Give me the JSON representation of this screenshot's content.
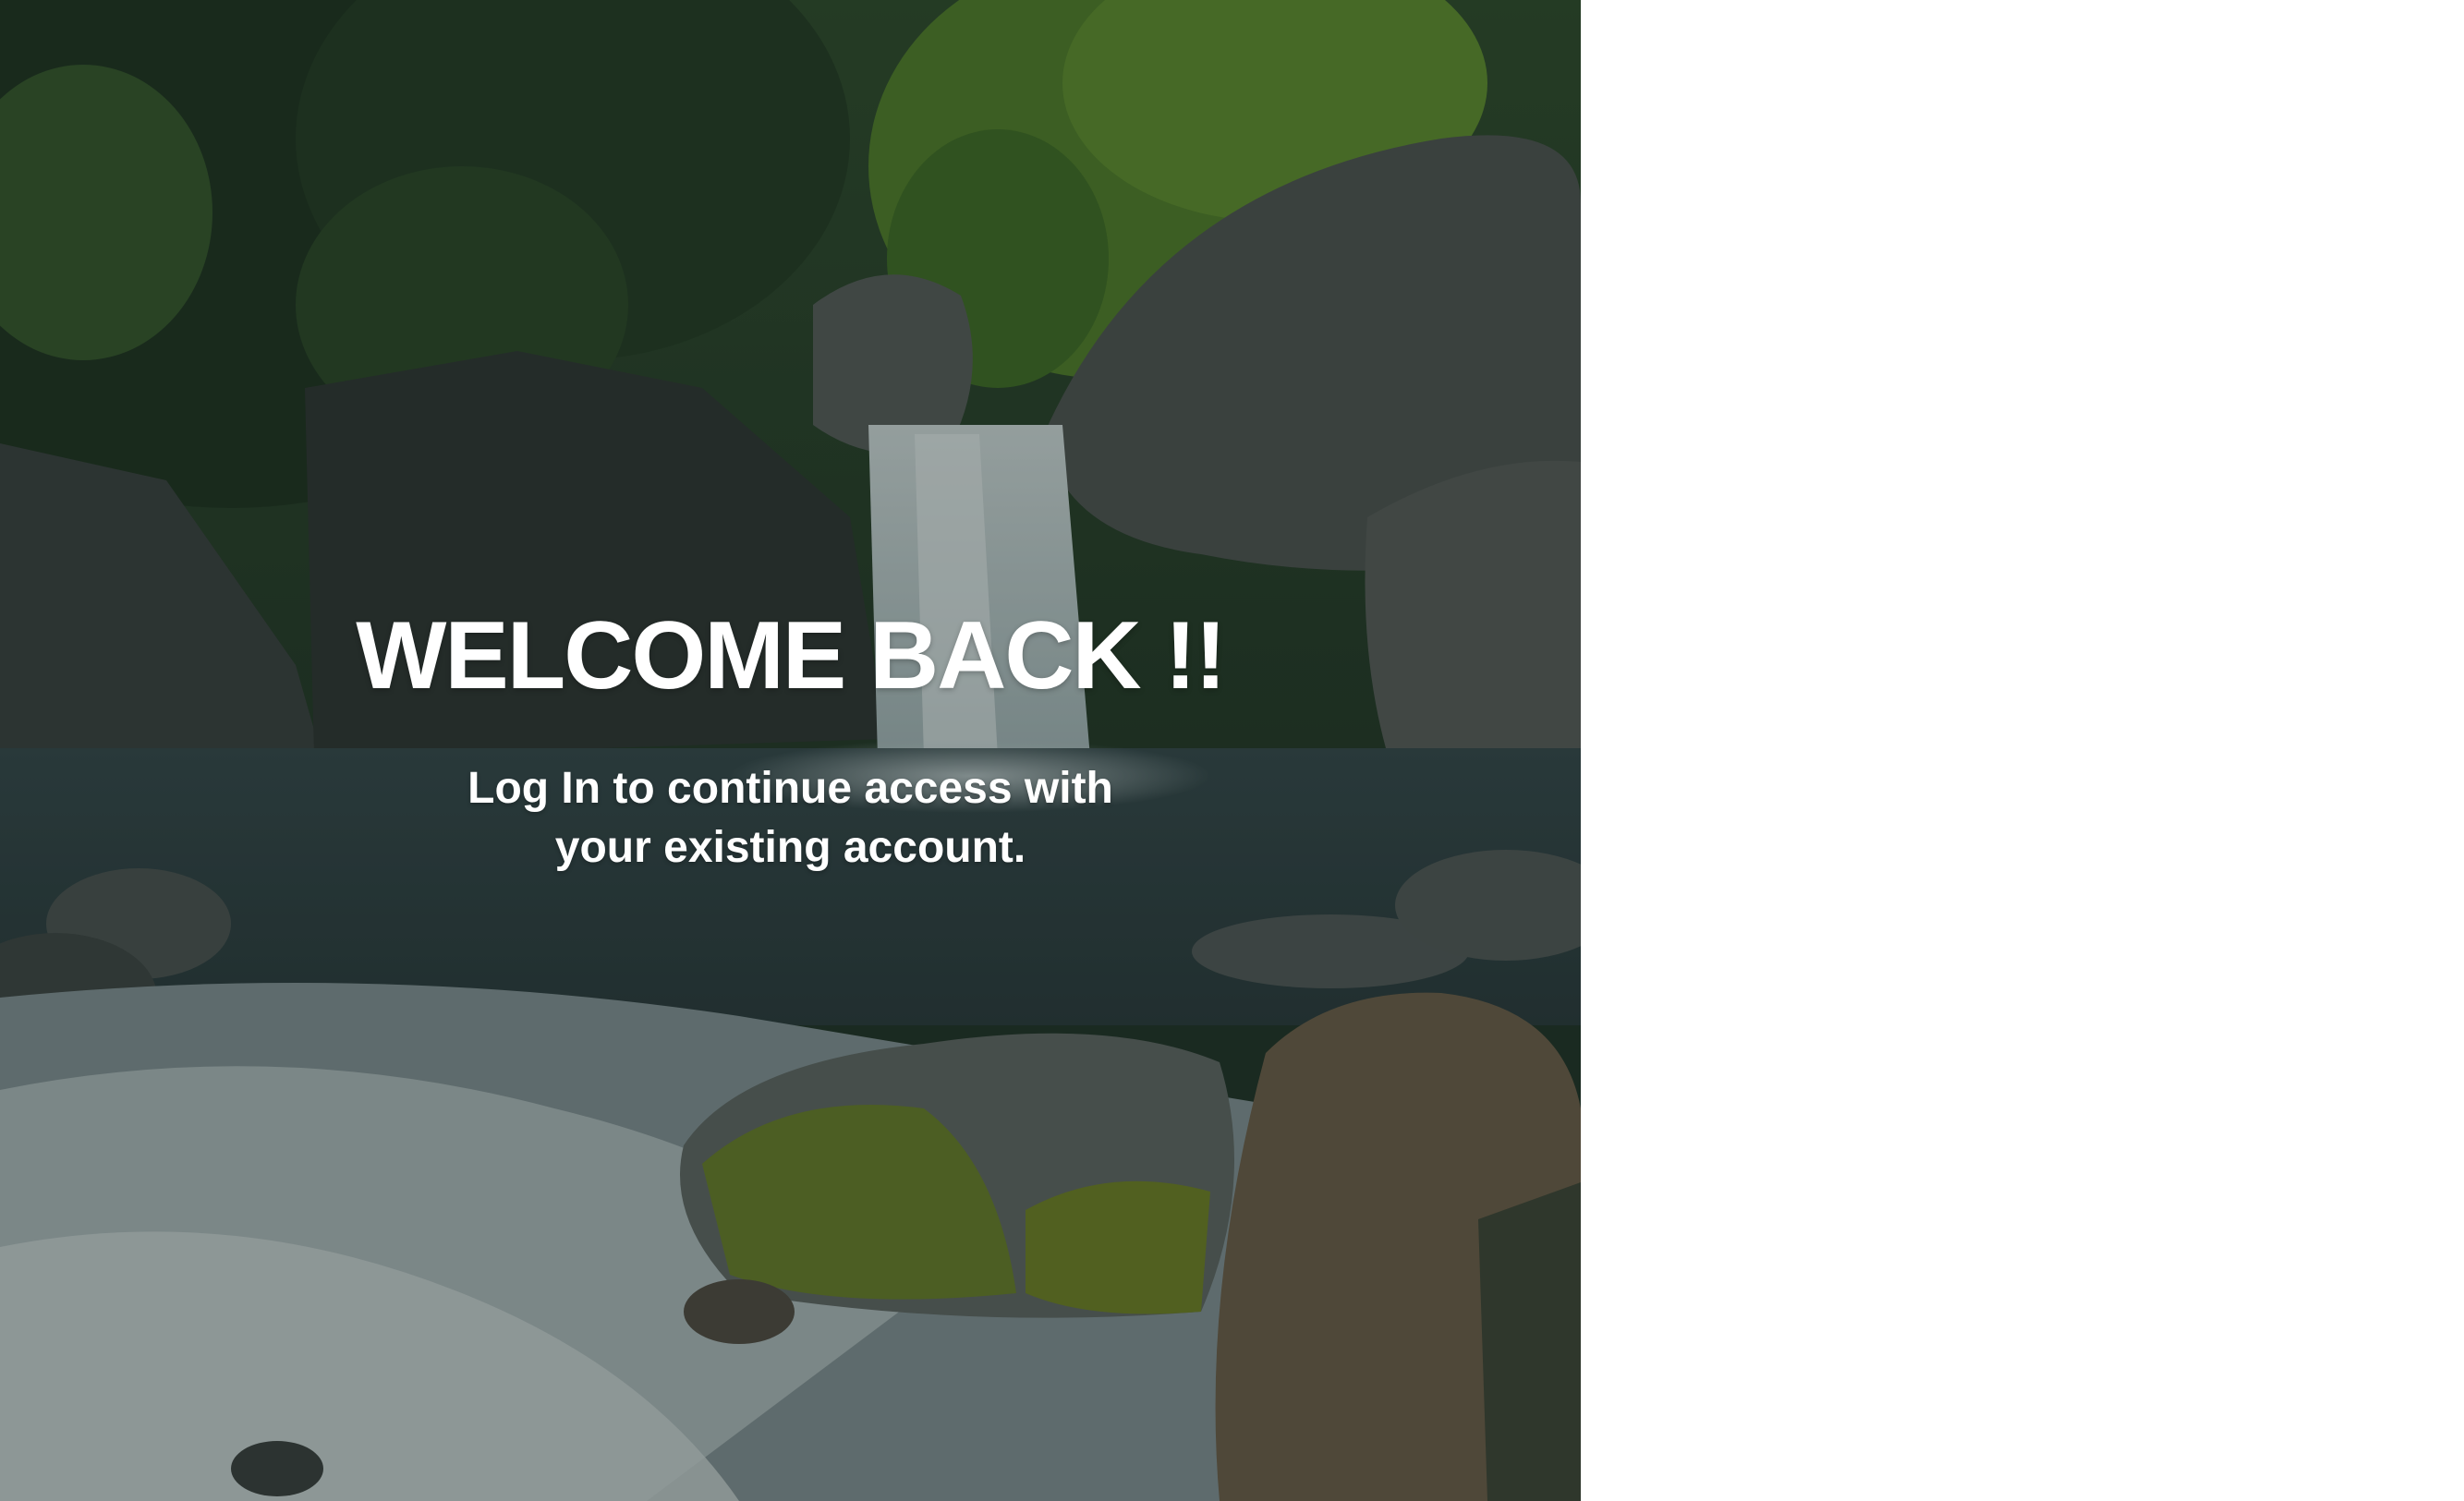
{
  "hero": {
    "image_icon": "waterfall-landscape",
    "title": "WELCOME BACK !!",
    "subtitle": "Log In to continue access with your existing account."
  },
  "colors": {
    "overlay": "#0a1412",
    "text": "#ffffff",
    "page_background": "#ffffff"
  }
}
